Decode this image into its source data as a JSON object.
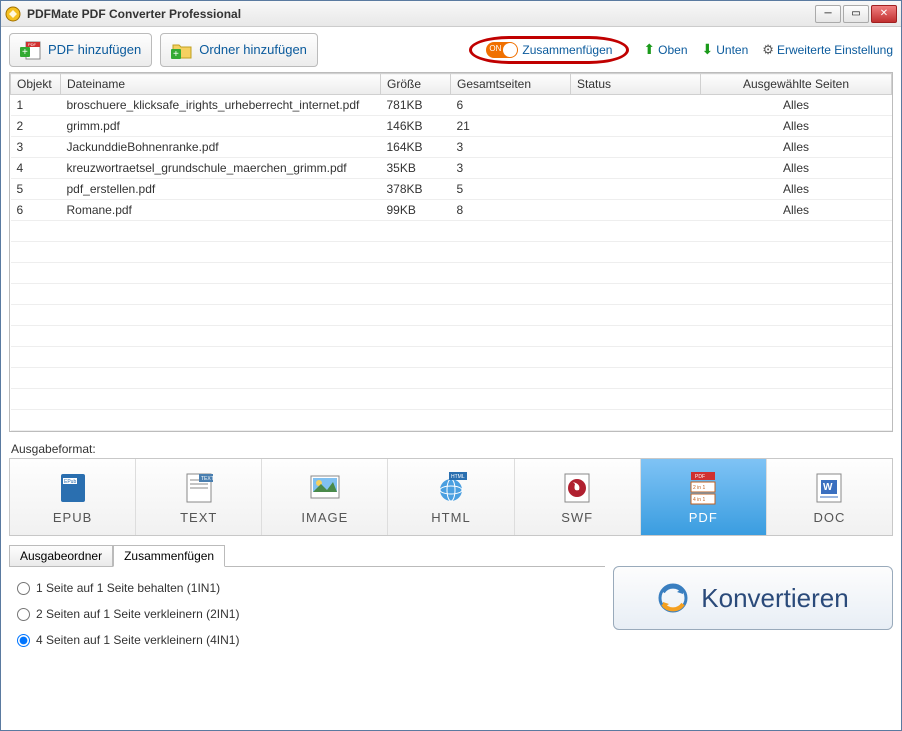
{
  "window": {
    "title": "PDFMate PDF Converter Professional"
  },
  "toolbar": {
    "add_pdf": "PDF hinzufügen",
    "add_folder": "Ordner hinzufügen",
    "merge": "Zusammenfügen",
    "up": "Oben",
    "down": "Unten",
    "settings": "Erweiterte Einstellung"
  },
  "table": {
    "headers": {
      "obj": "Objekt",
      "name": "Dateiname",
      "size": "Größe",
      "pages": "Gesamtseiten",
      "status": "Status",
      "selected": "Ausgewählte Seiten"
    },
    "rows": [
      {
        "obj": "1",
        "name": "broschuere_klicksafe_irights_urheberrecht_internet.pdf",
        "size": "781KB",
        "pages": "6",
        "status": "",
        "selected": "Alles"
      },
      {
        "obj": "2",
        "name": "grimm.pdf",
        "size": "146KB",
        "pages": "21",
        "status": "",
        "selected": "Alles"
      },
      {
        "obj": "3",
        "name": "JackunddieBohnenranke.pdf",
        "size": "164KB",
        "pages": "3",
        "status": "",
        "selected": "Alles"
      },
      {
        "obj": "4",
        "name": "kreuzwortraetsel_grundschule_maerchen_grimm.pdf",
        "size": "35KB",
        "pages": "3",
        "status": "",
        "selected": "Alles"
      },
      {
        "obj": "5",
        "name": "pdf_erstellen.pdf",
        "size": "378KB",
        "pages": "5",
        "status": "",
        "selected": "Alles"
      },
      {
        "obj": "6",
        "name": "Romane.pdf",
        "size": "99KB",
        "pages": "8",
        "status": "",
        "selected": "Alles"
      }
    ]
  },
  "format": {
    "label": "Ausgabeformat:",
    "items": [
      "EPUB",
      "TEXT",
      "IMAGE",
      "HTML",
      "SWF",
      "PDF",
      "DOC"
    ],
    "active": "PDF"
  },
  "bottom": {
    "tabs": {
      "output": "Ausgabeordner",
      "merge": "Zusammenfügen"
    },
    "options": {
      "opt1": "1 Seite auf 1 Seite behalten (1IN1)",
      "opt2": "2 Seiten auf 1 Seite verkleinern (2IN1)",
      "opt3": "4 Seiten auf 1 Seite verkleinern (4IN1)",
      "selected": "opt3"
    },
    "convert": "Konvertieren"
  }
}
